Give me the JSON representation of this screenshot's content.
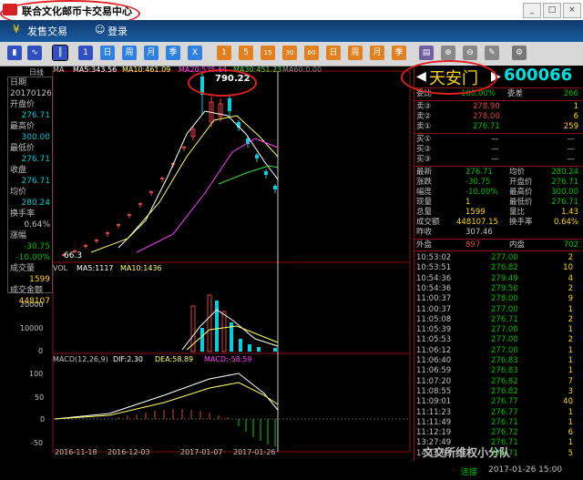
{
  "window": {
    "title": "联合文化邮币卡交易中心",
    "controls": [
      "_",
      "□",
      "×"
    ]
  },
  "menu": {
    "items": [
      "发售交易",
      "登录"
    ]
  },
  "toolbar": {
    "items": [
      "1",
      "5",
      "15",
      "30",
      "60",
      "日",
      "周",
      "月",
      "季",
      "X"
    ]
  },
  "chart": {
    "period_label": "日线",
    "ma_labels": [
      "MA",
      "MA5:343.56",
      "MA10:461.09",
      "MA20:535.64",
      "MA30:451.23",
      "MA60:0.00"
    ],
    "peak_label": "790.22",
    "low_label": "66.3",
    "vol_labels": [
      "VOL",
      "MA5:1117",
      "MA10:1436"
    ],
    "vol_ticks": [
      "10000",
      "20000",
      "0"
    ],
    "macd_labels": [
      "MACD(12,26,9)",
      "DIF:2.30",
      "DEA:58.89",
      "MACD:-58.59"
    ],
    "macd_ticks": [
      "100",
      "50",
      "0",
      "-50"
    ],
    "x_ticks": [
      "2016-11-18",
      "2016-12-03",
      "2017-01-07",
      "2017-01-26"
    ]
  },
  "side": {
    "items": [
      {
        "k": "日期",
        "v": "20170126"
      },
      {
        "k": "开盘价",
        "v": "276.71"
      },
      {
        "k": "最高价",
        "v": "300.00"
      },
      {
        "k": "最低价",
        "v": "276.71"
      },
      {
        "k": "收盘",
        "v": "276.71"
      },
      {
        "k": "均价",
        "v": "280.24"
      },
      {
        "k": "换手率",
        "v": "0.64%"
      },
      {
        "k": "涨幅",
        "v": "-30.75"
      },
      {
        "k": "",
        "v": "-10.00%"
      },
      {
        "k": "成交量",
        "v": "1599"
      },
      {
        "k": "成交金额",
        "v": "448107"
      }
    ]
  },
  "quote": {
    "name": "天安门",
    "code": "600066",
    "header_row": {
      "k1": "委比",
      "v1": "-100.00%",
      "k2": "委差",
      "v2": "266"
    },
    "sells": [
      {
        "k": "卖③",
        "price": "278.90",
        "vol": "1"
      },
      {
        "k": "卖②",
        "price": "278.00",
        "vol": "6"
      },
      {
        "k": "卖①",
        "price": "276.71",
        "vol": "259"
      }
    ],
    "buys": [
      {
        "k": "买①",
        "price": "—",
        "vol": "—"
      },
      {
        "k": "买②",
        "price": "—",
        "vol": "—"
      },
      {
        "k": "买③",
        "price": "—",
        "vol": "—"
      }
    ],
    "stats": [
      {
        "k1": "最新",
        "v1": "276.71",
        "k2": "均价",
        "v2": "280.24"
      },
      {
        "k1": "涨跌",
        "v1": "-30.75",
        "k2": "开盘价",
        "v2": "276.71"
      },
      {
        "k1": "幅度",
        "v1": "-10.00%",
        "k2": "最高价",
        "v2": "300.00"
      },
      {
        "k1": "现量",
        "v1": "1",
        "k2": "最低价",
        "v2": "276.71"
      },
      {
        "k1": "总量",
        "v1": "1599",
        "k2": "量比",
        "v2": "1.43"
      },
      {
        "k1": "成交额",
        "v1": "448107.15",
        "k2": "换手率",
        "v2": "0.64%"
      },
      {
        "k1": "昨收",
        "v1": "307.46",
        "k2": "",
        "v2": ""
      }
    ],
    "outer_inner": {
      "k1": "外盘",
      "v1": "897",
      "k2": "内盘",
      "v2": "702"
    },
    "ticks": [
      {
        "t": "10:53:02",
        "p": "277.00",
        "v": "2"
      },
      {
        "t": "10:53:51",
        "p": "276.82",
        "v": "10"
      },
      {
        "t": "10:54:36",
        "p": "279.49",
        "v": "4"
      },
      {
        "t": "10:54:36",
        "p": "279.50",
        "v": "2"
      },
      {
        "t": "11:00:37",
        "p": "278.00",
        "v": "9"
      },
      {
        "t": "11:00:37",
        "p": "277.00",
        "v": "1"
      },
      {
        "t": "11:05:08",
        "p": "276.71",
        "v": "2"
      },
      {
        "t": "11:05:39",
        "p": "277.00",
        "v": "1"
      },
      {
        "t": "11:05:53",
        "p": "277.00",
        "v": "2"
      },
      {
        "t": "11:06:12",
        "p": "277.00",
        "v": "1"
      },
      {
        "t": "11:06:40",
        "p": "276.83",
        "v": "1"
      },
      {
        "t": "11:06:59",
        "p": "276.83",
        "v": "1"
      },
      {
        "t": "11:07:20",
        "p": "276.82",
        "v": "7"
      },
      {
        "t": "11:08:55",
        "p": "276.82",
        "v": "3"
      },
      {
        "t": "11:09:01",
        "p": "276.77",
        "v": "40"
      },
      {
        "t": "11:11:23",
        "p": "276.77",
        "v": "1"
      },
      {
        "t": "11:11:49",
        "p": "276.71",
        "v": "1"
      },
      {
        "t": "11:12:19",
        "p": "276.72",
        "v": "6"
      },
      {
        "t": "13:27:49",
        "p": "276.71",
        "v": "1"
      },
      {
        "t": "14:12:03",
        "p": "276.71",
        "v": "5"
      }
    ],
    "status": {
      "conn": "连接",
      "date": "2017-01-26 15:00"
    },
    "watermark": "文交所维权小分队"
  }
}
